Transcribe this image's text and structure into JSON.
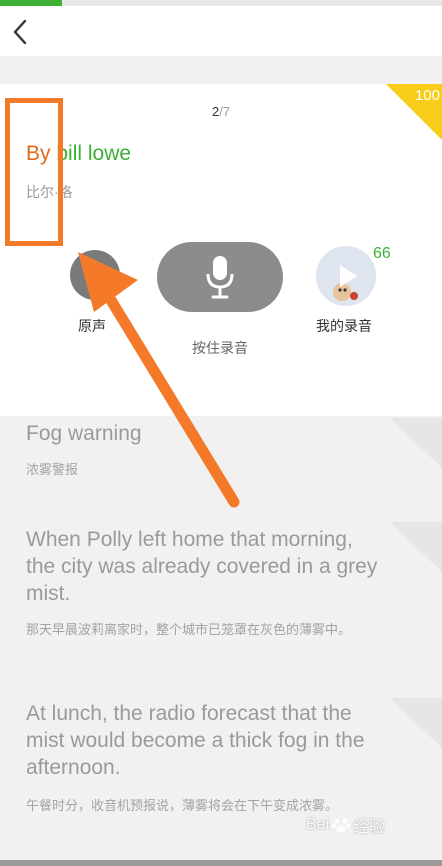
{
  "progress": {
    "fraction": 0.14,
    "fill_color": "#3cb034"
  },
  "score_badge": {
    "value": "100",
    "color": "#f8cd1a"
  },
  "counter": {
    "current": "2",
    "total": "/7"
  },
  "sentence": {
    "en_first": "By",
    "en_rest": " bill lowe",
    "cn": "比尔·洛",
    "colors": {
      "first_word": "#e06a1a",
      "rest": "#3cb034"
    }
  },
  "controls": {
    "original_label": "原声",
    "record_label": "按住录音",
    "my_recording_label": "我的录音",
    "my_score": "66"
  },
  "list": [
    {
      "en": "Fog warning",
      "cn": "浓雾警报"
    },
    {
      "en": "When Polly left home that morning, the city was already covered in a grey mist.",
      "cn": "那天早晨波莉离家时，整个城市已笼罩在灰色的薄雾中。"
    },
    {
      "en": "At lunch, the radio forecast that the mist would become a thick fog in the afternoon.",
      "cn": "午餐时分，收音机预报说，薄雾将会在下午变成浓雾。"
    }
  ],
  "annotation": {
    "color": "#f47a2a"
  },
  "watermark": {
    "text1": "Bai",
    "text2": "经验"
  },
  "icons": [
    "back-arrow-icon",
    "speaker-icon",
    "microphone-icon",
    "play-icon",
    "paw-icon"
  ]
}
